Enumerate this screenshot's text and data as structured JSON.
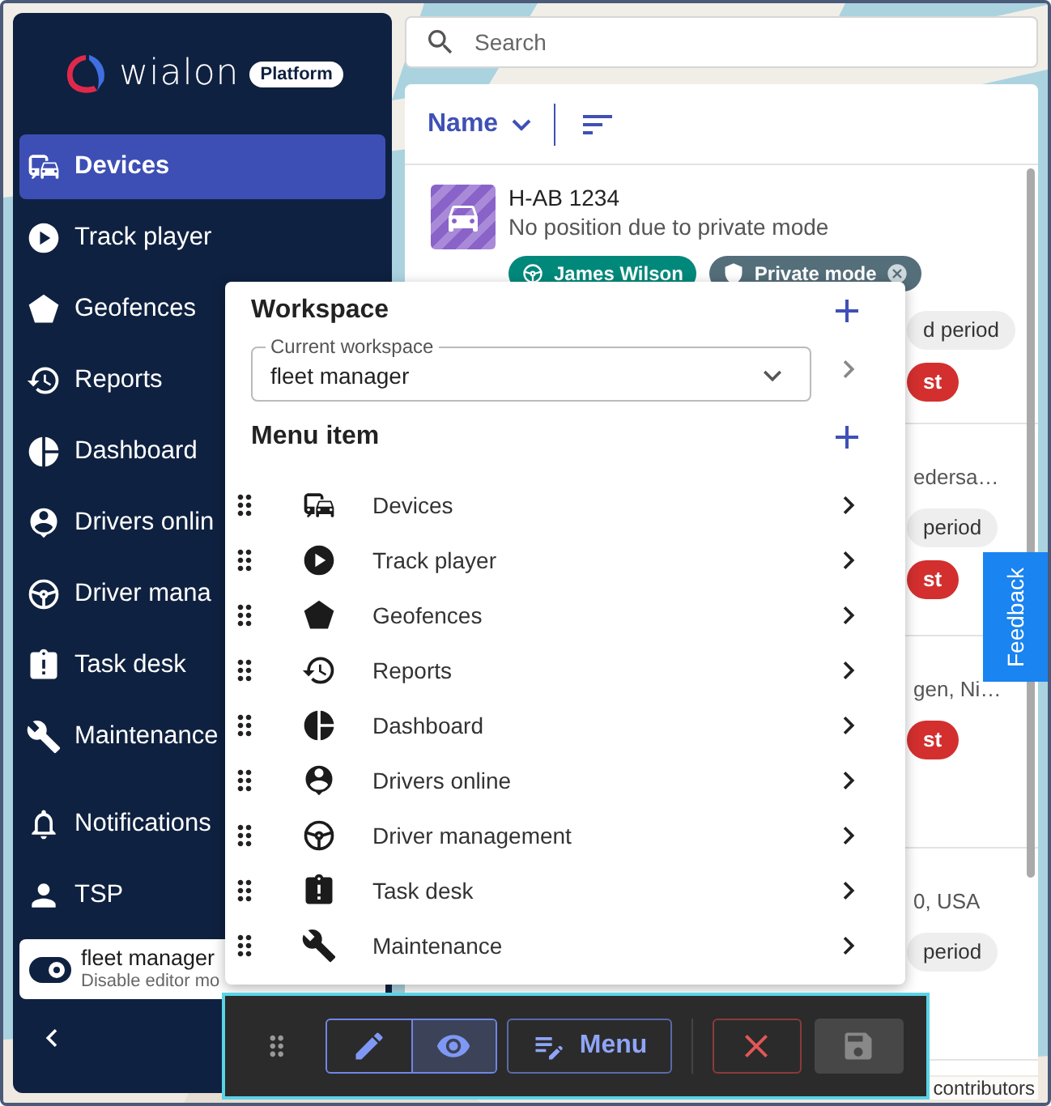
{
  "sidebar": {
    "logo": {
      "name": "wialon",
      "badge": "Platform"
    },
    "items": [
      {
        "label": "Devices",
        "selected": true
      },
      {
        "label": "Track player",
        "selected": false
      },
      {
        "label": "Geofences",
        "selected": false
      },
      {
        "label": "Reports",
        "selected": false
      },
      {
        "label": "Dashboard",
        "selected": false
      },
      {
        "label": "Drivers onlin",
        "selected": false
      },
      {
        "label": "Driver mana",
        "selected": false
      },
      {
        "label": "Task desk",
        "selected": false
      },
      {
        "label": "Maintenance",
        "selected": false
      }
    ],
    "secondary_items": [
      {
        "label": "Notifications"
      },
      {
        "label": "TSP"
      }
    ],
    "workspace": {
      "name": "fleet manager",
      "action": "Disable editor mo"
    }
  },
  "search": {
    "placeholder": "Search"
  },
  "device_list": {
    "sort": {
      "label": "Name"
    },
    "units": [
      {
        "name": "H-AB 1234",
        "status": "No position due to private mode",
        "chips": [
          {
            "label": "James Wilson",
            "color": "#00897b"
          },
          {
            "label": "Private mode",
            "color": "#546e7a"
          }
        ],
        "lines": [
          {
            "kind": "chip",
            "text": "d period",
            "color": "#eeeeee"
          },
          {
            "kind": "chip",
            "text": "st",
            "color": "#d32f2f"
          }
        ]
      },
      {
        "lines": [
          {
            "kind": "text",
            "text": "edersa…"
          },
          {
            "kind": "chip",
            "text": "period",
            "color": "#eeeeee"
          },
          {
            "kind": "chip",
            "text": "st",
            "color": "#d32f2f"
          }
        ]
      },
      {
        "lines": [
          {
            "kind": "text",
            "text": "gen, Ni…"
          },
          {
            "kind": "chip",
            "text": "st",
            "color": "#d32f2f"
          }
        ]
      },
      {
        "lines": [
          {
            "kind": "text",
            "text": "0, USA"
          },
          {
            "kind": "chip",
            "text": "period",
            "color": "#eeeeee"
          }
        ]
      }
    ]
  },
  "feedback": {
    "label": "Feedback"
  },
  "workspace_editor": {
    "title": "Workspace",
    "field": {
      "label": "Current workspace",
      "value": "fleet manager"
    },
    "menu_title": "Menu item",
    "menu_items": [
      {
        "label": "Devices"
      },
      {
        "label": "Track player"
      },
      {
        "label": "Geofences"
      },
      {
        "label": "Reports"
      },
      {
        "label": "Dashboard"
      },
      {
        "label": "Drivers online"
      },
      {
        "label": "Driver management"
      },
      {
        "label": "Task desk"
      },
      {
        "label": "Maintenance"
      }
    ]
  },
  "toolbar": {
    "modes": [
      {
        "kind": "edit",
        "selected": false
      },
      {
        "kind": "preview",
        "selected": true
      }
    ],
    "menu_label": "Menu",
    "save": {
      "disabled": true
    }
  },
  "attribution": "contributors"
}
